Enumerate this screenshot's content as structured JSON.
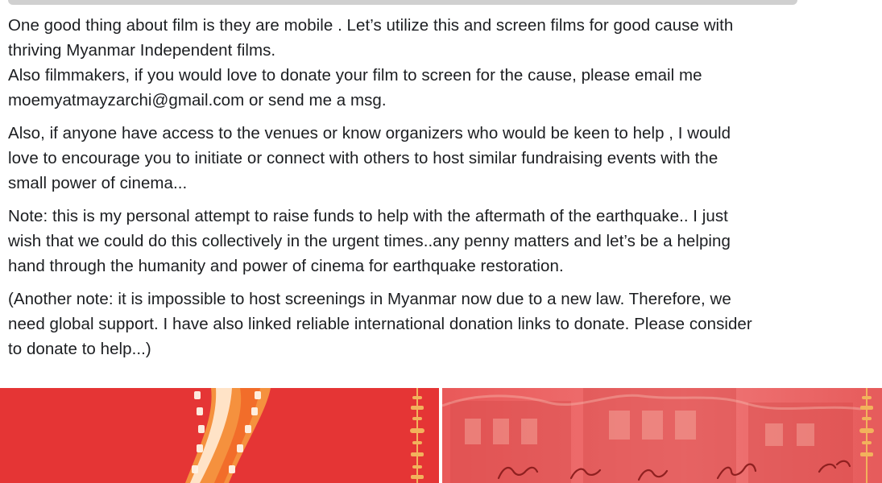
{
  "post": {
    "paragraph_1": {
      "lines": [
        "One good thing about film is they are mobile . Let’s utilize this and screen films for good cause with",
        "thriving Myanmar Independent films.",
        "Also filmmakers, if you would love to donate your film to screen for the cause, please email me",
        "moemyatmayzarchi@gmail.com or send me a msg."
      ]
    },
    "paragraph_2": {
      "lines": [
        "Also, if anyone have access to the venues or know organizers who would be keen to help , I would",
        "love to encourage you to initiate or connect with others to host similar fundraising events with the",
        "small power of cinema..."
      ]
    },
    "paragraph_3": {
      "lines": [
        "Note: this is my personal attempt to raise funds to help with the aftermath of the earthquake.. I just",
        "wish that we could do this collectively in the urgent times..any penny matters and let’s be a helping",
        "hand through the humanity and power of cinema for earthquake restoration."
      ]
    },
    "paragraph_4": {
      "lines": [
        "(Another note: it is impossible to host screenings in Myanmar now due to a new law. Therefore, we",
        "need global support. I have also linked reliable international donation links to donate. Please consider",
        "to donate to help...)"
      ]
    }
  },
  "images": {
    "left_image": {
      "background_color": "#e53535",
      "icon": "film-strip-icon",
      "accent_color": "#f5913e"
    },
    "right_image": {
      "background_color": "#ee6a6a",
      "icon": "building-photo-icon",
      "accent_color": "#f0a06a"
    }
  }
}
